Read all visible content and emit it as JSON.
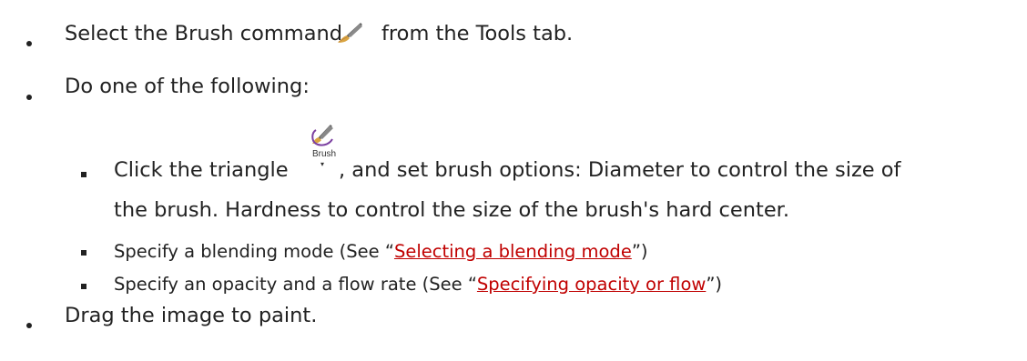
{
  "steps": [
    {
      "before": "Select the Brush command",
      "icon": "paintbrush-icon",
      "after": "from the Tools tab."
    },
    {
      "text": "Do one of the following:"
    },
    {
      "text": "Drag the image to paint."
    }
  ],
  "substeps": [
    {
      "before": "Click the triangle",
      "icon": "brush-dropdown-icon",
      "icon_label": "Brush",
      "after": ", and set brush options: Diameter to control the size of",
      "continuation": "the brush. Hardness to control the size of the brush's hard center."
    },
    {
      "before": "Specify a blending mode (See “",
      "link": "Selecting a blending mode",
      "after": "”)"
    },
    {
      "before": "Specify an opacity and a flow rate (See “",
      "link": "Specifying opacity or flow",
      "after": "”)"
    }
  ],
  "colors": {
    "text": "#222222",
    "link": "#c00000",
    "brush_accent": "#7b3fa0"
  }
}
